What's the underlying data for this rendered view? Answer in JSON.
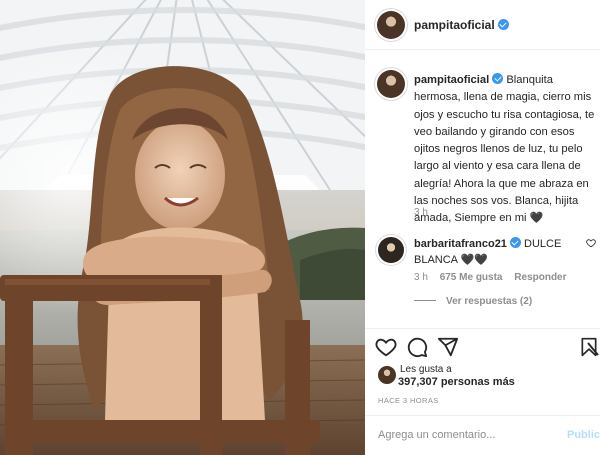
{
  "post": {
    "image_alt": "child with long curly hair hugging herself, sitting on a wooden chair under a white umbrella"
  },
  "header": {
    "username": "pampitaoficial",
    "more_icon": "ellipsis-icon"
  },
  "caption": {
    "username": "pampitaoficial",
    "text": "Blanquita hermosa, llena de magia, cierro mis ojos y escucho tu risa contagiosa, te veo bailando y girando con esos ojitos negros llenos de luz, tu pelo largo al viento y esa cara llena de alegría! Ahora la que me abraza en las noches sos vos. Blanca, hijita amada, Siempre en mi",
    "emoji": "🖤",
    "time": "3 h"
  },
  "comment": {
    "username": "barbaritafranco21",
    "text": "DULCE BLANCA",
    "emoji": "🖤🖤",
    "time": "3 h",
    "likes": "675 Me gusta",
    "reply": "Responder",
    "view_replies": "Ver respuestas (2)"
  },
  "actions": {
    "icons": [
      "heart-icon",
      "comment-icon",
      "share-icon",
      "bookmark-icon"
    ]
  },
  "likes": {
    "label": "Les gusta a",
    "count": "397,307 personas más"
  },
  "timestamp": "HACE 3 HORAS",
  "add_comment": {
    "placeholder": "Agrega un comentario...",
    "publish": "Publica"
  },
  "colors": {
    "verified": "#3897f0",
    "publish_disabled": "#b2dffc",
    "secondary_text": "#8e8e8e"
  }
}
